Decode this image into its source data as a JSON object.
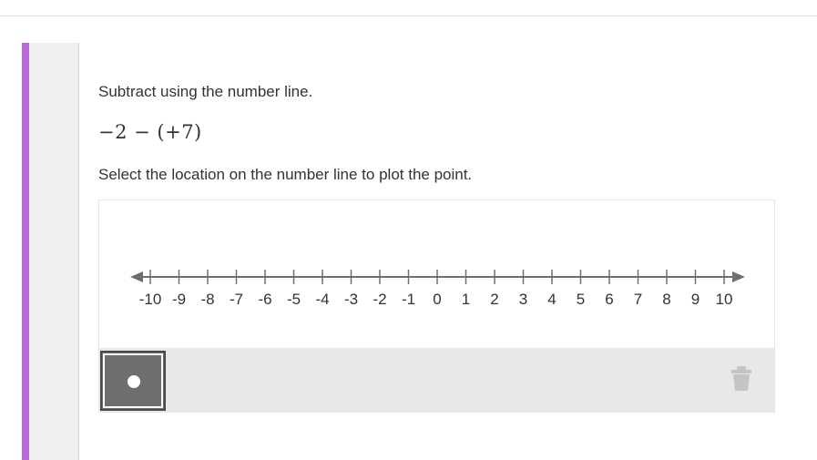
{
  "question": {
    "prompt": "Subtract using the number line.",
    "expression": "−2 − (+7)",
    "instruction": "Select the location on the number line to plot the point."
  },
  "number_line": {
    "min": -10,
    "max": 10,
    "step": 1,
    "tick_labels": [
      "-10",
      "-9",
      "-8",
      "-7",
      "-6",
      "-5",
      "-4",
      "-3",
      "-2",
      "-1",
      "0",
      "1",
      "2",
      "3",
      "4",
      "5",
      "6",
      "7",
      "8",
      "9",
      "10"
    ],
    "plotted_points": []
  },
  "toolbar": {
    "point_tool_icon": "point-dot-icon",
    "delete_icon": "trash-icon"
  },
  "colors": {
    "accent": "#b56cd6",
    "axis": "#6e6e6e",
    "tool_active": "#6e6e6e",
    "trash": "#c4c4c4"
  }
}
